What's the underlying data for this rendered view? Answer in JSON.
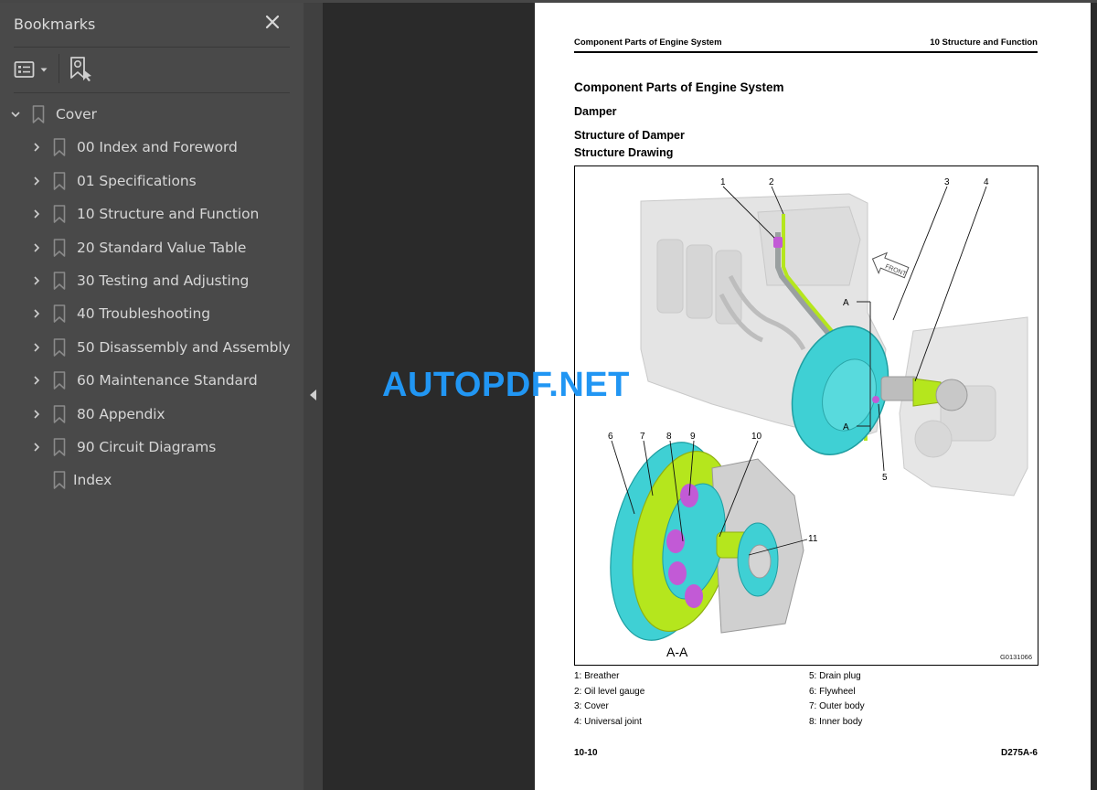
{
  "sidebar": {
    "title": "Bookmarks",
    "close_icon": "close-icon",
    "tools": {
      "options_icon": "list-options-icon",
      "dropdown_icon": "caret-down-icon",
      "find_bookmark_icon": "bookmark-search-icon"
    },
    "items": [
      {
        "label": "Cover",
        "level": 0,
        "expanded": true,
        "has_children": true
      },
      {
        "label": "00 Index and Foreword",
        "level": 1,
        "expanded": false,
        "has_children": true
      },
      {
        "label": "01 Specifications",
        "level": 1,
        "expanded": false,
        "has_children": true
      },
      {
        "label": "10 Structure and Function",
        "level": 1,
        "expanded": false,
        "has_children": true
      },
      {
        "label": "20 Standard Value Table",
        "level": 1,
        "expanded": false,
        "has_children": true
      },
      {
        "label": "30 Testing and Adjusting",
        "level": 1,
        "expanded": false,
        "has_children": true
      },
      {
        "label": "40 Troubleshooting",
        "level": 1,
        "expanded": false,
        "has_children": true
      },
      {
        "label": "50 Disassembly and Assembly",
        "level": 1,
        "expanded": false,
        "has_children": true
      },
      {
        "label": "60 Maintenance Standard",
        "level": 1,
        "expanded": false,
        "has_children": true
      },
      {
        "label": "80 Appendix",
        "level": 1,
        "expanded": false,
        "has_children": true
      },
      {
        "label": "90 Circuit Diagrams",
        "level": 1,
        "expanded": false,
        "has_children": true
      },
      {
        "label": "Index",
        "level": 1,
        "expanded": false,
        "has_children": false
      }
    ]
  },
  "watermark": "AUTOPDF.NET",
  "page": {
    "running_header_left": "Component Parts of Engine System",
    "running_header_right": "10 Structure and Function",
    "heading": "Component Parts of Engine System",
    "subheading": "Damper",
    "section": "Structure of Damper",
    "subsection": "Structure Drawing",
    "figure": {
      "id": "G0131066",
      "section_label": "A-A",
      "section_marker": "A",
      "front_label": "FRONT",
      "callouts": [
        "1",
        "2",
        "3",
        "4",
        "5",
        "6",
        "7",
        "8",
        "9",
        "10",
        "11"
      ]
    },
    "legend_left": [
      "1: Breather",
      "2: Oil level gauge",
      "3: Cover",
      "4: Universal joint"
    ],
    "legend_right": [
      "5: Drain plug",
      "6: Flywheel",
      "7: Outer body",
      "8: Inner body"
    ],
    "footer_left": "10-10",
    "footer_right": "D275A-6"
  },
  "colors": {
    "accent_cyan": "#3fd0d4",
    "accent_green": "#b5e61d",
    "accent_magenta": "#c25ad6",
    "watermark_blue": "#2196f3"
  }
}
